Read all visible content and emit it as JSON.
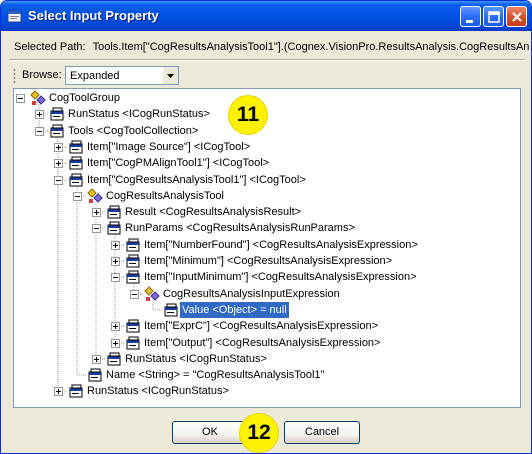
{
  "window": {
    "title": "Select Input Property",
    "selected_path_label": "Selected Path:",
    "selected_path_value": "Tools.Item[\"CogResultsAnalysisTool1\"].(Cognex.VisionPro.ResultsAnalysis.CogResultsAnal"
  },
  "toolbar": {
    "browse_label": "Browse:",
    "browse_value": "Expanded"
  },
  "tree": {
    "nodes": [
      {
        "label": "CogToolGroup",
        "icon": "tool-group-icon",
        "expander": "minus"
      },
      {
        "label": "RunStatus <ICogRunStatus>",
        "icon": "property-icon",
        "expander": "plus"
      },
      {
        "label": "Tools <CogToolCollection>",
        "icon": "property-icon",
        "expander": "minus"
      },
      {
        "label": "Item[\"Image Source\"] <ICogTool>",
        "icon": "property-icon",
        "expander": "plus"
      },
      {
        "label": "Item[\"CogPMAlignTool1\"] <ICogTool>",
        "icon": "property-icon",
        "expander": "plus"
      },
      {
        "label": "Item[\"CogResultsAnalysisTool1\"] <ICogTool>",
        "icon": "property-icon",
        "expander": "minus"
      },
      {
        "label": "CogResultsAnalysisTool",
        "icon": "tool-group-icon",
        "expander": "minus"
      },
      {
        "label": "Result <CogResultsAnalysisResult>",
        "icon": "property-icon",
        "expander": "plus"
      },
      {
        "label": "RunParams <CogResultsAnalysisRunParams>",
        "icon": "property-icon",
        "expander": "minus"
      },
      {
        "label": "Item[\"NumberFound\"] <CogResultsAnalysisExpression>",
        "icon": "property-icon",
        "expander": "plus"
      },
      {
        "label": "Item[\"Minimum\"] <CogResultsAnalysisExpression>",
        "icon": "property-icon",
        "expander": "plus"
      },
      {
        "label": "Item[\"InputMinimum\"] <CogResultsAnalysisExpression>",
        "icon": "property-icon",
        "expander": "minus"
      },
      {
        "label": "CogResultsAnalysisInputExpression",
        "icon": "tool-group-icon",
        "expander": "minus"
      },
      {
        "label": "Value <Object> = null",
        "icon": "property-icon",
        "expander": "none"
      },
      {
        "label": "Item[\"ExprC\"] <CogResultsAnalysisExpression>",
        "icon": "property-icon",
        "expander": "plus"
      },
      {
        "label": "Item[\"Output\"] <CogResultsAnalysisExpression>",
        "icon": "property-icon",
        "expander": "plus"
      },
      {
        "label": "RunStatus <ICogRunStatus>",
        "icon": "property-icon",
        "expander": "plus"
      },
      {
        "label": "Name <String> = \"CogResultsAnalysisTool1\"",
        "icon": "property-icon",
        "expander": "none"
      },
      {
        "label": "RunStatus <ICogRunStatus>",
        "icon": "property-icon",
        "expander": "plus"
      }
    ]
  },
  "buttons": {
    "ok_label": "OK",
    "cancel_label": "Cancel"
  },
  "callouts": {
    "tree_badge": "11",
    "buttons_badge": "12"
  },
  "colors": {
    "title_bar": "#0355e4",
    "selection": "#316ac5",
    "badge": "#fff200",
    "dialog_face": "#ece9d8"
  }
}
